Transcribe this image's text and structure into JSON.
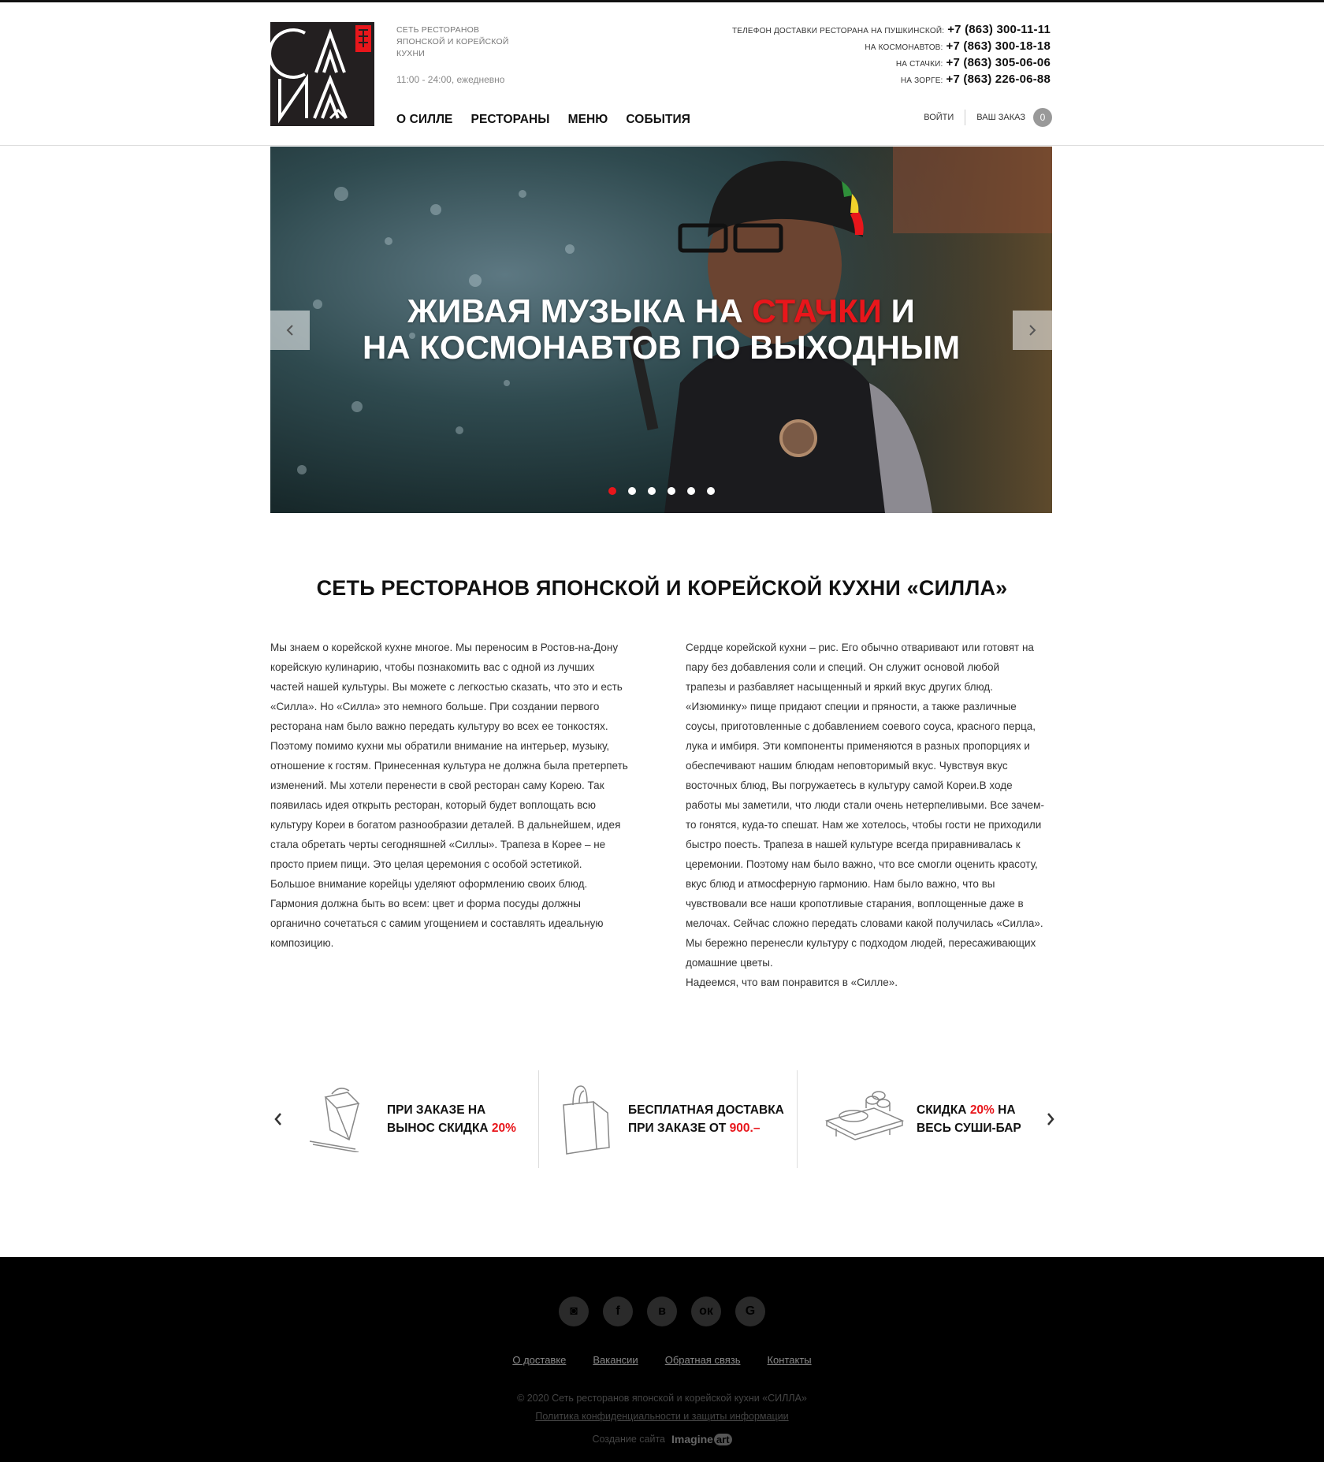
{
  "brand": {
    "logo_text": "СИЛЛА",
    "tagline": "СЕТЬ РЕСТОРАНОВ ЯПОНСКОЙ И КОРЕЙСКОЙ КУХНИ",
    "hours": "11:00 - 24:00, ежедневно"
  },
  "nav": {
    "items": [
      "О СИЛЛЕ",
      "РЕСТОРАНЫ",
      "МЕНЮ",
      "СОБЫТИЯ"
    ]
  },
  "phones": [
    {
      "label": "ТЕЛЕФОН ДОСТАВКИ РЕСТОРАНА НА ПУШКИНСКОЙ:",
      "number": "+7 (863) 300-11-11"
    },
    {
      "label": "НА КОСМОНАВТОВ:",
      "number": "+7 (863) 300-18-18"
    },
    {
      "label": "НА СТАЧКИ:",
      "number": "+7 (863) 305-06-06"
    },
    {
      "label": "НА ЗОРГЕ:",
      "number": "+7 (863) 226-06-88"
    }
  ],
  "account": {
    "login_label": "ВОЙТИ",
    "order_label": "ВАШ ЗАКАЗ",
    "cart_count": "0"
  },
  "slider": {
    "title_part1": "ЖИВАЯ МУЗЫКА НА ",
    "title_highlight": "СТАЧКИ",
    "title_part2": " И",
    "title_line2": "НА КОСМОНАВТОВ ПО ВЫХОДНЫМ",
    "slide_count": 6,
    "active_index": 0,
    "highlight_color": "#e8161b"
  },
  "about": {
    "title": "СЕТЬ РЕСТОРАНОВ ЯПОНСКОЙ И КОРЕЙСКОЙ КУХНИ «СИЛЛА»",
    "left_text": "Мы знаем о корейской кухне многое. Мы переносим в Ростов-на-Дону\nкорейскую кулинарию, чтобы познакомить вас с одной из лучших\nчастей нашей культуры. Вы можете с легкостью сказать, что это и есть\n«Силла». Но «Силла» это немного больше. При создании первого\nресторана нам было важно передать культуру во всех ее тонкостях.\nПоэтому помимо кухни мы обратили внимание на интерьер, музыку,\nотношение к гостям. Принесенная культура не должна была претерпеть\nизменений. Мы хотели перенести в свой ресторан саму Корею. Так\nпоявилась идея открыть ресторан, который будет воплощать всю\nкультуру Кореи в богатом разнообразии деталей. В дальнейшем, идея\nстала обретать черты сегодняшней «Силлы». Трапеза в Корее – не\nпросто прием пищи. Это целая церемония с особой эстетикой.\nБольшое внимание корейцы уделяют оформлению своих блюд.\nГармония должна быть во всем: цвет и форма посуды должны\nорганично сочетаться с самим угощением и составлять идеальную\nкомпозицию.",
    "right_text": "Сердце корейской кухни – рис. Его обычно отваривают или готовят на\nпару без добавления соли и специй. Он служит основой любой\nтрапезы и разбавляет насыщенный и яркий вкус других блюд.\n«Изюминку» пище придают специи и пряности, а также различные\nсоусы, приготовленные с добавлением соевого соуса, красного перца,\nлука и имбиря. Эти компоненты применяются в разных пропорциях и\nобеспечивают нашим блюдам неповторимый вкус. Чувствуя вкус\nвосточных блюд, Вы погружаетесь в культуру самой Кореи.В ходе\nработы мы заметили, что люди стали очень нетерпеливыми. Все зачем-\nто гонятся, куда-то спешат. Нам же хотелось, чтобы гости не приходили\nбыстро поесть. Трапеза в нашей культуре всегда приравнивалась к\nцеремонии. Поэтому нам было важно, что все смогли оценить красоту,\nвкус блюд и атмосферную гармонию. Нам было важно, что вы\nчувствовали все наши кропотливые старания, воплощенные даже в\nмелочах. Сейчас сложно передать словами какой получилась «Силла».\nМы бережно перенесли культуру с подходом людей, пересаживающих\nдомашние цветы.\nНадеемся, что вам понравится в «Силле»."
  },
  "promos": [
    {
      "icon": "takeaway-box-icon",
      "line1": "ПРИ ЗАКАЗЕ НА",
      "line2": "ВЫНОС СКИДКА ",
      "highlight": "20%",
      "after": ""
    },
    {
      "icon": "shopping-bag-icon",
      "line1": "БЕСПЛАТНАЯ ДОСТАВКА",
      "line2": "ПРИ ЗАКАЗЕ ОТ ",
      "highlight": "900.–",
      "after": ""
    },
    {
      "icon": "sushi-board-icon",
      "line1": "СКИДКА ",
      "line1_highlight": "20%",
      "line1_after": " НА",
      "line2": "ВЕСЬ СУШИ-БАР"
    }
  ],
  "footer": {
    "socials": [
      "instagram-icon",
      "facebook-icon",
      "vk-icon",
      "odnoklassniki-icon",
      "gplus-icon"
    ],
    "social_glyphs": [
      "◙",
      "f",
      "в",
      "ок",
      "G"
    ],
    "links": [
      "О доставке",
      "Вакансии",
      "Обратная связь",
      "Контакты"
    ],
    "copyright": "© 2020 Сеть ресторанов японской и корейской кухни «СИЛЛА»",
    "policy": "Политика конфиденциальности и защиты информации",
    "made_by_label": "Создание сайта",
    "made_by_brand": "Imagine",
    "made_by_brand_art": "art"
  },
  "colors": {
    "accent": "#e8161b",
    "footer_bg": "#000000",
    "text": "#111111"
  }
}
